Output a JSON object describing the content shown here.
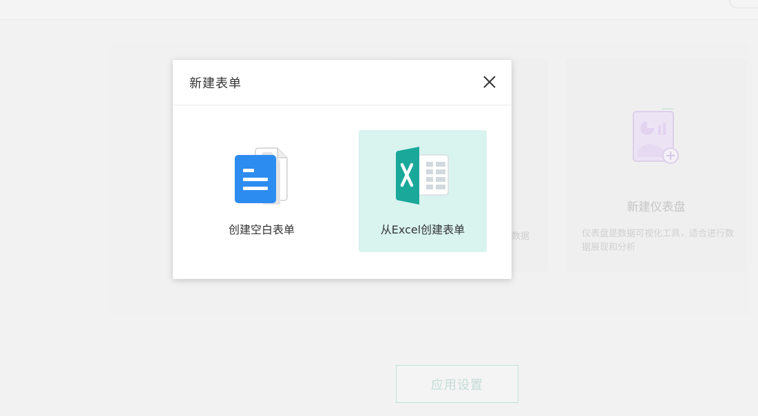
{
  "background": {
    "dashboard_card": {
      "title": "新建仪表盘",
      "description": "仪表盘是数据可视化工具，适合进行数据展现和分析"
    },
    "mid_card_fragment": "数据",
    "apply_button": "应用设置"
  },
  "modal": {
    "title": "新建表单",
    "close_icon": "close-icon",
    "options": [
      {
        "label": "创建空白表单",
        "icon": "blank-document-icon"
      },
      {
        "label": "从Excel创建表单",
        "icon": "excel-icon",
        "selected": true
      }
    ]
  },
  "colors": {
    "accent": "#1db3a0",
    "selected_bg": "#d9f3ef",
    "blank_doc_blue": "#2d8cf0"
  }
}
